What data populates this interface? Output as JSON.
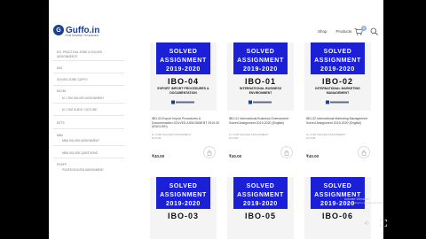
{
  "header": {
    "logo_name": "Guffo.in",
    "logo_mark": "G",
    "logo_tagline": "YOUR DOORWAY TO LEARNING",
    "nav": [
      "Shop",
      "Products"
    ],
    "cart_count": "0"
  },
  "sidebar": {
    "items": [
      "B.E. PRACTICAL ZONE & SOLVED",
      "ASSIGNMENTS",
      "MLE",
      "SOLVED ZONE GUFFO",
      "MCOM",
      "M. COM SOLVED ASSIGNMENT",
      "M. COM GUIDE / OUTLINE",
      "MTTS",
      "MBA",
      "MBA SOLVED ASSIGNMENT",
      "MBA SOLVED QUESTIONS",
      "PGDFP",
      "PGDFM SOLVED ASSIGNMENT"
    ]
  },
  "products": [
    {
      "banner_line1": "SOLVED",
      "banner_line2": "ASSIGNMENT",
      "banner_line3": "2019-2020",
      "code": "IBO-04",
      "subject": "EXPORT IMPORT PROCEDURES & DOCUMENTATION",
      "description": "IBO-04 Export Import Procedures & Documentation SOLVED ASSIGNMENT 2019-20 (ENGLISH)",
      "category": "M. COM SOLVED ASSIGNMENT",
      "subcategory": "M.COM",
      "price": "₹40.00"
    },
    {
      "banner_line1": "SOLVED",
      "banner_line2": "ASSIGNMENT",
      "banner_line3": "2019-2020",
      "code": "IBO-01",
      "subject": "INTERNATIONAL BUSINESS ENVIRONMENT",
      "description": "IBO-01 International Business Environment Solved Assignment 2019-2020 (English)",
      "category": "M. COM SOLVED ASSIGNMENT",
      "subcategory": "M.COM",
      "price": "₹40.00"
    },
    {
      "banner_line1": "SOLVED",
      "banner_line2": "ASSIGNMENT",
      "banner_line3": "2019-2020",
      "code": "IBO-02",
      "subject": "INTERNATIONAL MARKETING MANAGEMENT",
      "description": "IBO-02 International Marketing Management Solved Assignment 2019-2020 (English)",
      "category": "M. COM SOLVED ASSIGNMENT",
      "subcategory": "M.COM",
      "price": "₹40.00"
    },
    {
      "banner_line1": "SOLVED",
      "banner_line2": "ASSIGNMENT",
      "banner_line3": "2019-2020",
      "code": "IBO-03"
    },
    {
      "banner_line1": "SOLVED",
      "banner_line2": "ASSIGNMENT",
      "banner_line3": "2019-2020",
      "code": "IBO-05"
    },
    {
      "banner_line1": "SOLVED",
      "banner_line2": "ASSIGNMENT",
      "banner_line3": "2019-2020",
      "code": "IBO-06"
    }
  ],
  "watermark": {
    "line1": "Activate Windows",
    "line2": "Go to Settings to activate Windows."
  },
  "colors": {
    "banner_blue": "#1b1fd6",
    "brand_navy": "#1a3f8c",
    "page_bg": "#ffffff",
    "frame_bg": "#000000"
  }
}
